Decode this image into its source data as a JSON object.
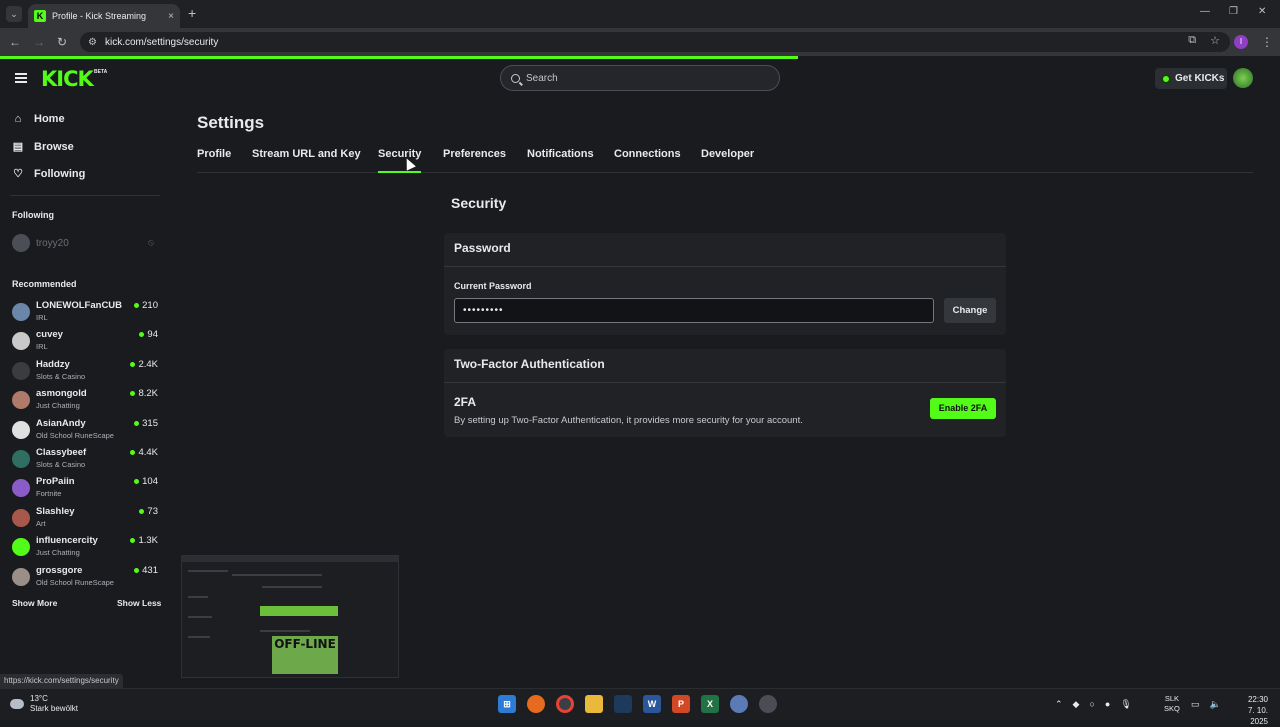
{
  "browser": {
    "tab_title": "Profile - Kick Streaming",
    "tab_close": "×",
    "new_tab": "+",
    "url": "kick.com/settings/security",
    "profile_initial": "I",
    "status_url": "https://kick.com/settings/security"
  },
  "header": {
    "logo": "KICK",
    "beta": "BETA",
    "search_placeholder": "Search",
    "get_kicks": "Get KICKs"
  },
  "sidebar": {
    "nav": [
      {
        "label": "Home",
        "icon": "home-icon"
      },
      {
        "label": "Browse",
        "icon": "browse-icon"
      },
      {
        "label": "Following",
        "icon": "heart-icon"
      }
    ],
    "following_header": "Following",
    "following": [
      {
        "name": "troyy20",
        "status": "offline"
      }
    ],
    "recommended_header": "Recommended",
    "recommended": [
      {
        "name": "LONEWOLFanCUB",
        "category": "IRL",
        "viewers": "210",
        "color": "#6a86a8"
      },
      {
        "name": "cuvey",
        "category": "IRL",
        "viewers": "94",
        "color": "#c8c8c8"
      },
      {
        "name": "Haddzy",
        "category": "Slots & Casino",
        "viewers": "2.4K",
        "color": "#3a3c40"
      },
      {
        "name": "asmongold",
        "category": "Just Chatting",
        "viewers": "8.2K",
        "color": "#b07a6a"
      },
      {
        "name": "AsianAndy",
        "category": "Old School RuneScape",
        "viewers": "315",
        "color": "#e0e0e0"
      },
      {
        "name": "Classybeef",
        "category": "Slots & Casino",
        "viewers": "4.4K",
        "color": "#2f6f62"
      },
      {
        "name": "ProPaiin",
        "category": "Fortnite",
        "viewers": "104",
        "color": "#8a5cc8"
      },
      {
        "name": "Slashley",
        "category": "Art",
        "viewers": "73",
        "color": "#a8584a"
      },
      {
        "name": "influencercity",
        "category": "Just Chatting",
        "viewers": "1.3K",
        "color": "#53fc18"
      },
      {
        "name": "grossgore",
        "category": "Old School RuneScape",
        "viewers": "431",
        "color": "#9a8f88"
      }
    ],
    "show_more": "Show More",
    "show_less": "Show Less"
  },
  "settings": {
    "title": "Settings",
    "tabs": [
      "Profile",
      "Stream URL and Key",
      "Security",
      "Preferences",
      "Notifications",
      "Connections",
      "Developer"
    ],
    "active_tab": "Security",
    "section_title": "Security",
    "password": {
      "header": "Password",
      "label": "Current Password",
      "value": "•••••••••",
      "button": "Change"
    },
    "twofa": {
      "header": "Two-Factor Authentication",
      "title": "2FA",
      "description": "By setting up Two-Factor Authentication, it provides more security for your account.",
      "button": "Enable 2FA"
    }
  },
  "preview": {
    "offline_text": "OFF-LINE"
  },
  "taskbar": {
    "temperature": "13°C",
    "weather": "Stark bewölkt",
    "lang_top": "SLK",
    "lang_bottom": "SKQ",
    "time": "22:30",
    "date": "7. 10. 2025"
  },
  "colors": {
    "accent": "#53fc18",
    "background": "#191b1f",
    "card": "#202226"
  }
}
